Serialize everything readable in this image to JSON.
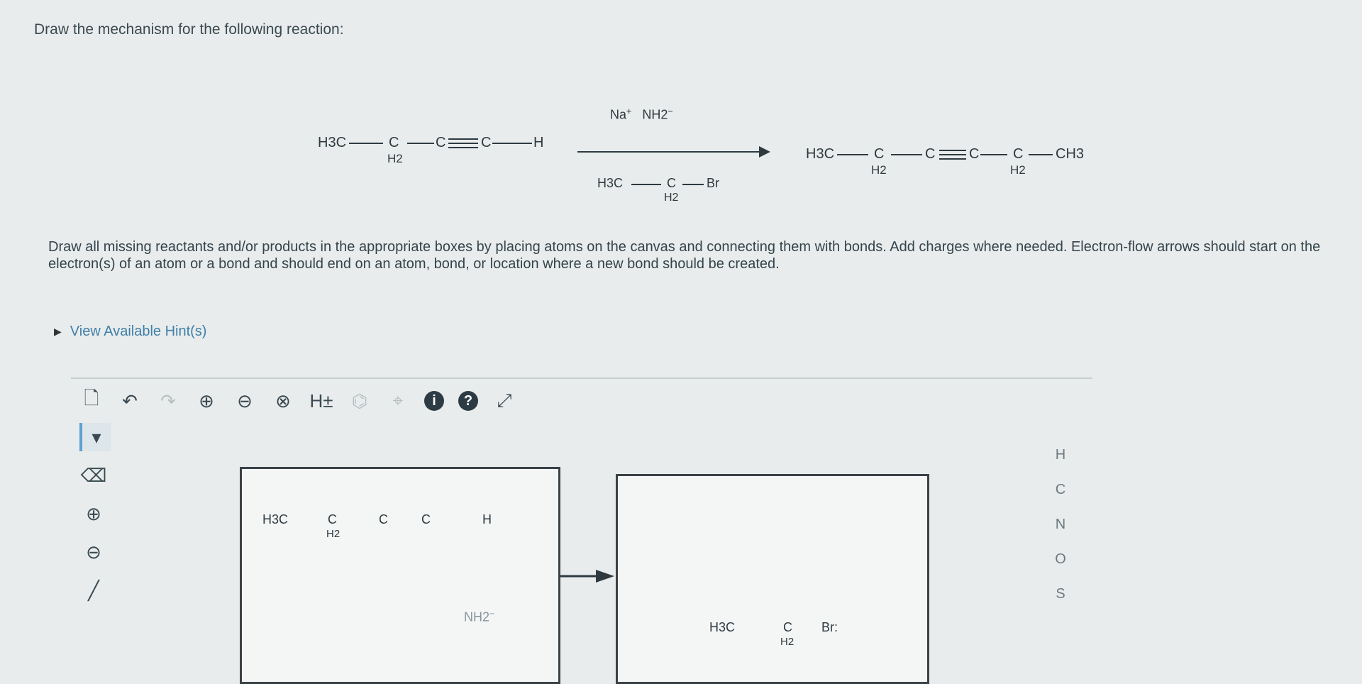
{
  "prompt": {
    "title": "Draw the mechanism for the following reaction:",
    "instructions": "Draw all missing reactants and/or products in the appropriate boxes by placing atoms on the canvas and connecting them with bonds. Add charges where needed. Electron-flow arrows should start on the electron(s) of an atom or a bond and should end on an atom, bond, or location where a new bond should be created.",
    "hint_link": "View Available Hint(s)"
  },
  "reaction": {
    "reactant": {
      "methyl": "H3C",
      "methylene": "C",
      "h2": "H2",
      "alkyne_c1": "C",
      "alkyne_c2": "C",
      "terminal_h": "H"
    },
    "reagent_top": {
      "na": "Na",
      "plus": "+",
      "nh2": "NH2",
      "minus": "−"
    },
    "reagent_bottom": {
      "methyl": "H3C",
      "methylene": "C",
      "h2": "H2",
      "br": "Br"
    },
    "product": {
      "methyl": "H3C",
      "c1": "C",
      "h2a": "H2",
      "alkyne_c1": "C",
      "alkyne_c2": "C",
      "c2": "C",
      "h2b": "H2",
      "ch3": "CH3"
    }
  },
  "toolbar": {
    "h_charge": "H±"
  },
  "right_panel": {
    "atoms": [
      "H",
      "C",
      "N",
      "O",
      "S"
    ]
  },
  "canvas": {
    "box1": {
      "methyl": "H3C",
      "methylene": "C",
      "h2": "H2",
      "alkyne_c1": "C",
      "alkyne_c2": "C",
      "terminal_h": "H",
      "amide": "NH2",
      "amide_charge": "−"
    },
    "box2": {
      "methyl": "H3C",
      "methylene": "C",
      "h2": "H2",
      "br": "Br",
      "lone_pair": ":"
    }
  }
}
